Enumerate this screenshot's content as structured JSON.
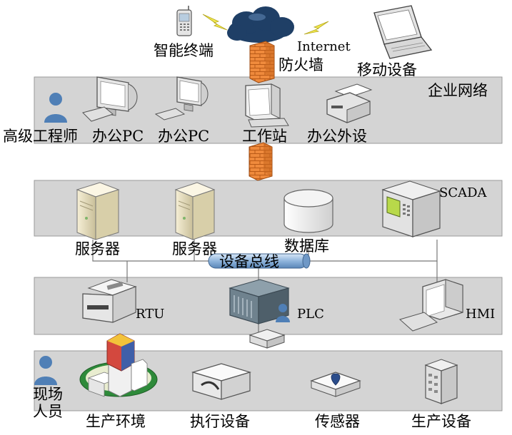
{
  "top": {
    "smart_terminal": "智能终端",
    "internet": "Internet",
    "firewall": "防火墙",
    "mobile_device": "移动设备"
  },
  "enterprise": {
    "layer_label": "企业网络",
    "senior_engineer": "高级工程师",
    "office_pc_1": "办公PC",
    "office_pc_2": "办公PC",
    "workstation": "工作站",
    "office_peripheral": "办公外设"
  },
  "scada": {
    "layer_label": "SCADA",
    "server_1": "服务器",
    "server_2": "服务器",
    "database": "数据库"
  },
  "bus": {
    "label": "设备总线"
  },
  "control": {
    "rtu": "RTU",
    "plc": "PLC",
    "hmi": "HMI"
  },
  "field": {
    "field_personnel_line1": "现场",
    "field_personnel_line2": "人员",
    "production_env": "生产环境",
    "actuator": "执行设备",
    "sensor": "传感器",
    "production_equipment": "生产设备"
  },
  "colors": {
    "band_fill": "#d4d4d4",
    "firewall": "#ef8a3c",
    "person": "#4f7fb6",
    "cloud": "#1f3f66",
    "bolt": "#f2e94e"
  }
}
